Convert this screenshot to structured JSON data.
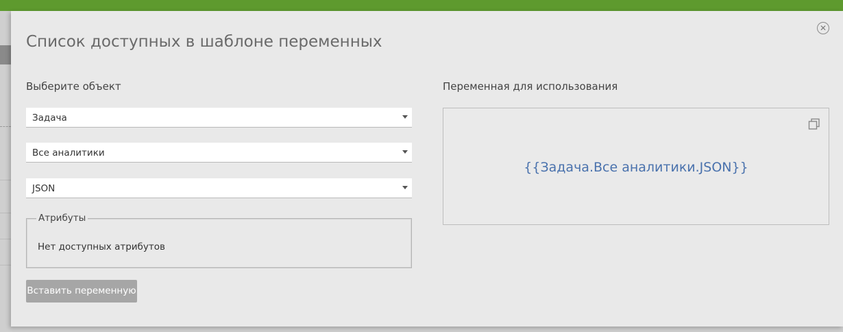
{
  "modal": {
    "title": "Список доступных в шаблоне переменных",
    "close_glyph": "✕"
  },
  "left": {
    "object_label": "Выберите объект",
    "selects": [
      {
        "value": "Задача"
      },
      {
        "value": "Все аналитики"
      },
      {
        "value": "JSON"
      }
    ],
    "attributes": {
      "legend": "Атрибуты",
      "empty_text": "Нет доступных атрибутов"
    },
    "insert_button": "Вставить переменную"
  },
  "right": {
    "variable_label": "Переменная для использования",
    "variable_value": "{{Задача.Все аналитики.JSON}}"
  },
  "icons": {
    "close": "close-icon",
    "copy": "copy-icon",
    "dropdown": "chevron-down-icon"
  },
  "colors": {
    "topbar": "#5e9a2e",
    "modal_bg": "#e9e9e9",
    "variable_text": "#4a72ad",
    "button_disabled": "#a6a6a6"
  }
}
